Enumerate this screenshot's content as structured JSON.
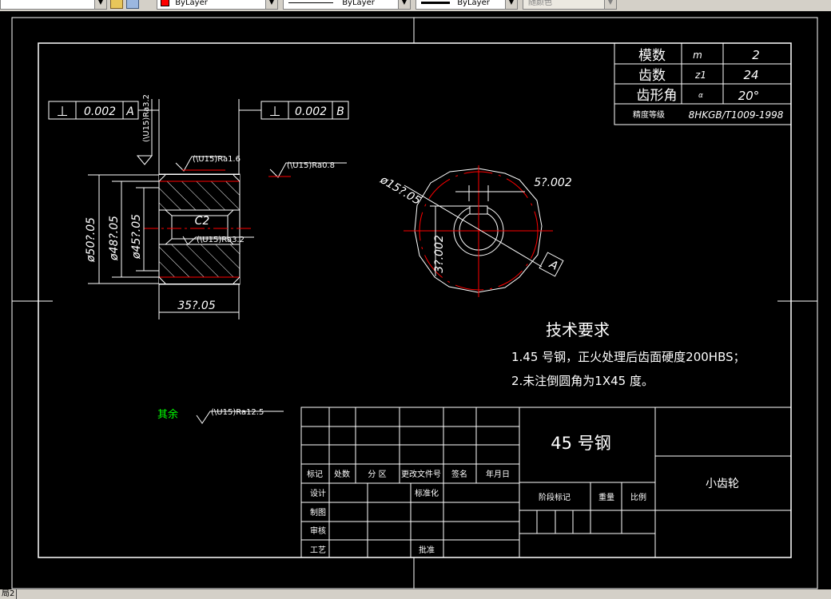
{
  "toolbar": {
    "color_value": "ByLayer",
    "linetype_value": "ByLayer",
    "lineweight_value": "ByLayer",
    "plotstyle_value": "随颜色",
    "accent_red": "#ff0000"
  },
  "status": {
    "layout_tab": "局2"
  },
  "drawing": {
    "params_table": {
      "rows": [
        {
          "label": "模数",
          "symbol": "m",
          "value": "2"
        },
        {
          "label": "齿数",
          "symbol": "z1",
          "value": "24"
        },
        {
          "label": "齿形角",
          "symbol": "α",
          "value": "20°"
        },
        {
          "label": "精度等级",
          "symbol": "",
          "value": "8HKGB/T1009-1998"
        }
      ]
    },
    "tolerance_left": {
      "symbol": "⊥",
      "value": "0.002",
      "datum": "A"
    },
    "tolerance_right": {
      "symbol": "⊥",
      "value": "0.002",
      "datum": "B"
    },
    "roughness": {
      "vertical": "(\\U15)Ra3.2",
      "top_left": "(\\U15)Ra1.6",
      "top_right": "(\\U15)Ra0.8",
      "bore": "(\\U15)Ra3.2",
      "rest": "(\\U15)Ra12.5",
      "rest_label": "其余"
    },
    "dims": {
      "d1": "ø50?.05",
      "d2": "ø48?.05",
      "d3": "ø45?.05",
      "width": "35?.05",
      "chamfer": "C2",
      "bore_dia": "ø15?.05",
      "key_width": "5?.002",
      "key_depth": "3?.002",
      "datum_a": "A"
    },
    "tech_req": {
      "title": "技术要求",
      "line1": "1.45 号钢，正火处理后齿面硬度200HBS；",
      "line2": "2.未注倒圆角为1X45 度。"
    },
    "title_block": {
      "headers": [
        "标记",
        "处数",
        "分 区",
        "更改文件号",
        "签名",
        "年月日"
      ],
      "row_labels": [
        "设计",
        "制图",
        "审核",
        "工艺"
      ],
      "standardize": "标准化",
      "approve": "批准",
      "material": "45 号钢",
      "part_name": "小齿轮",
      "stage_mark": "阶段标记",
      "weight": "重量",
      "scale": "比例"
    }
  }
}
